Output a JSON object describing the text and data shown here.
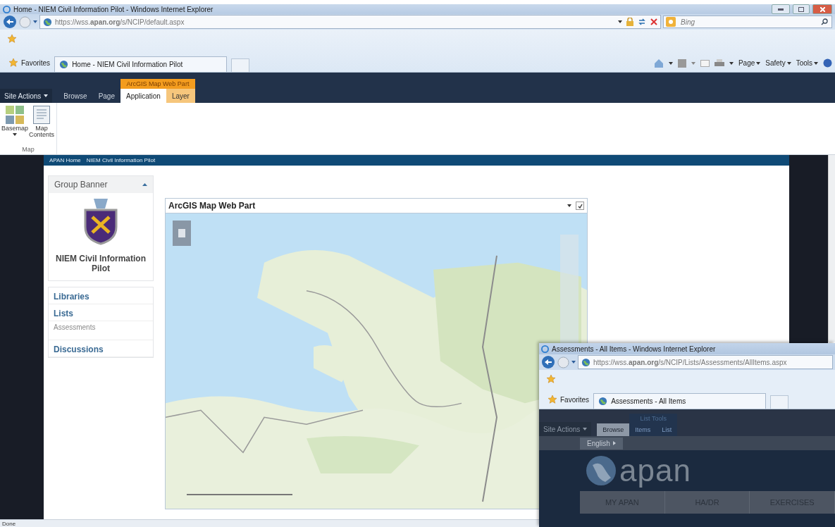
{
  "window": {
    "title": "Home - NIEM Civil Information Pilot - Windows Internet Explorer"
  },
  "address_bar": {
    "url": "https://wss.**apan.org**/s/NCIP/default.aspx"
  },
  "search": {
    "placeholder": "Bing"
  },
  "favorites": {
    "label": "Favorites"
  },
  "browser_tabs": [
    {
      "label": "Home - NIEM Civil Information Pilot",
      "selected": true
    }
  ],
  "command_bar": [
    "Page",
    "Safety",
    "Tools"
  ],
  "ribbon": {
    "site_actions": "Site Actions",
    "context_group": "ArcGIS Map Web Part",
    "tabs": [
      {
        "label": "Browse",
        "selected": false,
        "kind": "standard"
      },
      {
        "label": "Page",
        "selected": false,
        "kind": "standard"
      },
      {
        "label": "Application",
        "selected": true,
        "kind": "contextual"
      },
      {
        "label": "Layer",
        "selected": false,
        "kind": "contextual"
      }
    ],
    "buttons": [
      {
        "label": "Basemap",
        "kind": "dropdown"
      },
      {
        "label": "Map Contents",
        "kind": "plain"
      }
    ],
    "group_label": "Map"
  },
  "breadcrumb": [
    "APAN Home",
    "NIEM Civil Information Pilot"
  ],
  "group_banner": {
    "title": "Group Banner",
    "site_name": "NIEM Civil Information Pilot"
  },
  "quick_launch": [
    {
      "label": "Libraries",
      "kind": "heading"
    },
    {
      "label": "Lists",
      "kind": "heading"
    },
    {
      "label": "Assessments",
      "kind": "link"
    },
    {
      "label": "Discussions",
      "kind": "heading"
    }
  ],
  "web_part": {
    "title": "ArcGIS Map Web Part",
    "checked": true
  },
  "status_bar": {
    "text": "Done"
  },
  "second_window": {
    "title": "Assessments - All Items - Windows Internet Explorer",
    "url": "https://wss.**apan.org**/s/NCIP/Lists/Assessments/AllItems.aspx",
    "favorites": "Favorites",
    "tab": "Assessments - All Items",
    "site_actions": "Site Actions",
    "context_group": "List Tools",
    "tabs": [
      {
        "label": "Browse",
        "selected": true
      },
      {
        "label": "Items",
        "selected": false
      },
      {
        "label": "List",
        "selected": false
      }
    ],
    "language": "English",
    "logo": "apan",
    "nav": [
      "MY APAN",
      "HA/DR",
      "EXERCISES"
    ]
  }
}
